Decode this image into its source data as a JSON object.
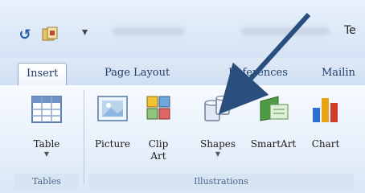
{
  "window": {
    "title_fragment": "Te"
  },
  "tabs": [
    {
      "label": "Insert",
      "active": true
    },
    {
      "label": "Page Layout",
      "active": false
    },
    {
      "label": "References",
      "active": false
    },
    {
      "label": "Mailin",
      "active": false
    }
  ],
  "groups": {
    "tables": {
      "label": "Tables"
    },
    "illustrations": {
      "label": "Illustrations"
    }
  },
  "buttons": {
    "table": {
      "label": "Table",
      "dropdown": true
    },
    "picture": {
      "label": "Picture"
    },
    "clip_art": {
      "label_line1": "Clip",
      "label_line2": "Art"
    },
    "shapes": {
      "label": "Shapes",
      "dropdown": true
    },
    "smartart": {
      "label": "SmartArt"
    },
    "chart": {
      "label": "Chart"
    }
  },
  "colors": {
    "ribbon_bg": "#e8f0fb",
    "tab_text": "#1f3d6b",
    "arrow": "#2a4f7f"
  },
  "icons": [
    "undo-icon",
    "office-icon",
    "table-icon",
    "picture-icon",
    "clip-art-icon",
    "shapes-icon",
    "smartart-icon",
    "chart-icon",
    "dropdown-arrow-icon",
    "annotation-arrow-icon"
  ]
}
